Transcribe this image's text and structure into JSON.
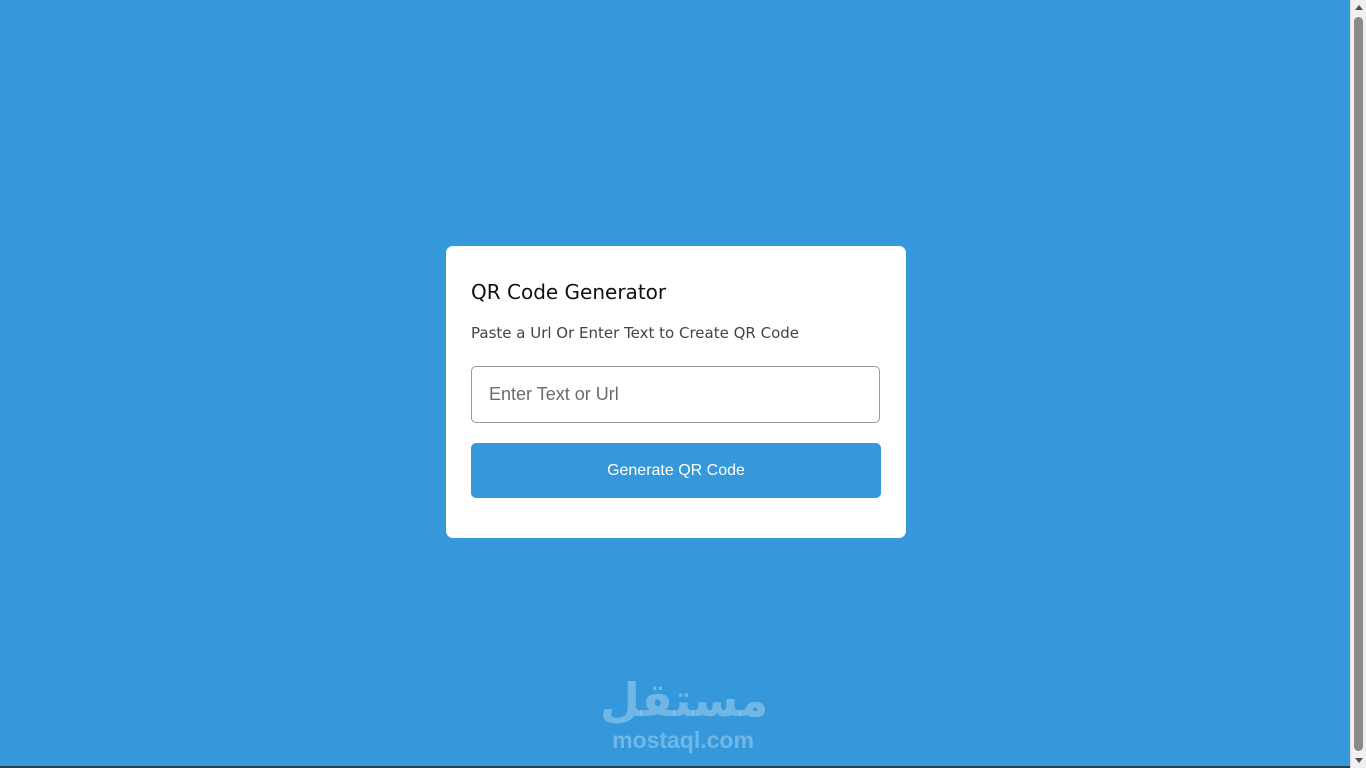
{
  "card": {
    "title": "QR Code Generator",
    "subtitle": "Paste a Url Or Enter Text to Create QR Code",
    "input_placeholder": "Enter Text or Url",
    "input_value": "",
    "button_label": "Generate QR Code"
  },
  "watermark": {
    "arabic": "مستقل",
    "latin": "mostaql.com"
  },
  "colors": {
    "background": "#3498db",
    "card": "#ffffff",
    "button": "#3498db"
  }
}
